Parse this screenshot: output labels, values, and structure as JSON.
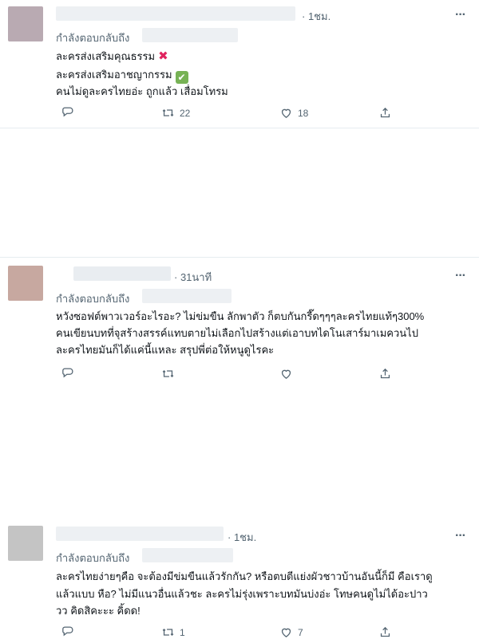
{
  "replying_label": "กำลังตอบกลับถึง",
  "tweets": [
    {
      "time": "1ชม.",
      "more": "···",
      "lines": [
        "ละครส่งเสริมคุณธรรม",
        "ละครส่งเสริมอาชญากรรม",
        "คนไม่ดูละครไทยอ่ะ ถูกแล้ว เสื่อมโทรม"
      ],
      "retweets": "22",
      "likes": "18"
    },
    {
      "time": "31นาที",
      "more": "···",
      "lines": [
        "หวังซอฟต์พาวเวอร์อะไรอะ? ไม่ข่มขืน ลักพาตัว ก็ตบกันกรี๊ดๆๆๆละครไทยแท้ๆ300%",
        "คนเขียนบทที่จุสร้างสรรค์แทบตายไม่เลือกไปสร้างแต่เอาบทไดโนเสาร์มาเมควนไป",
        "ละครไทยมันก็ได้แค่นี้แหละ สรุปพี่ต่อให้หนูดูไรคะ"
      ],
      "retweets": "",
      "likes": ""
    },
    {
      "time": "1ชม.",
      "more": "···",
      "lines": [
        "ละครไทยง่ายๆคือ จะต้องมีข่มขืนแล้วรักกัน? หรือตบตีแย่งผัวชาวบ้านอันนี้ก็มี คือเราดู",
        "แล้วแบบ หือ? ไม่มีแนวอื่นแล้วชะ ละครไม่รุ่งเพราะบทมันบ่งอ่ะ โทษคนดูไม่ได้อะปาว",
        "วว คิดสิคะะะ คิ้ดด!"
      ],
      "retweets": "1",
      "likes": "7"
    }
  ],
  "icons": [
    "reply-icon",
    "retweet-icon",
    "like-icon",
    "share-icon"
  ],
  "colors": {
    "text": "#0f1419",
    "muted": "#536471",
    "cross": "#e0245e",
    "check": "#77b255"
  }
}
